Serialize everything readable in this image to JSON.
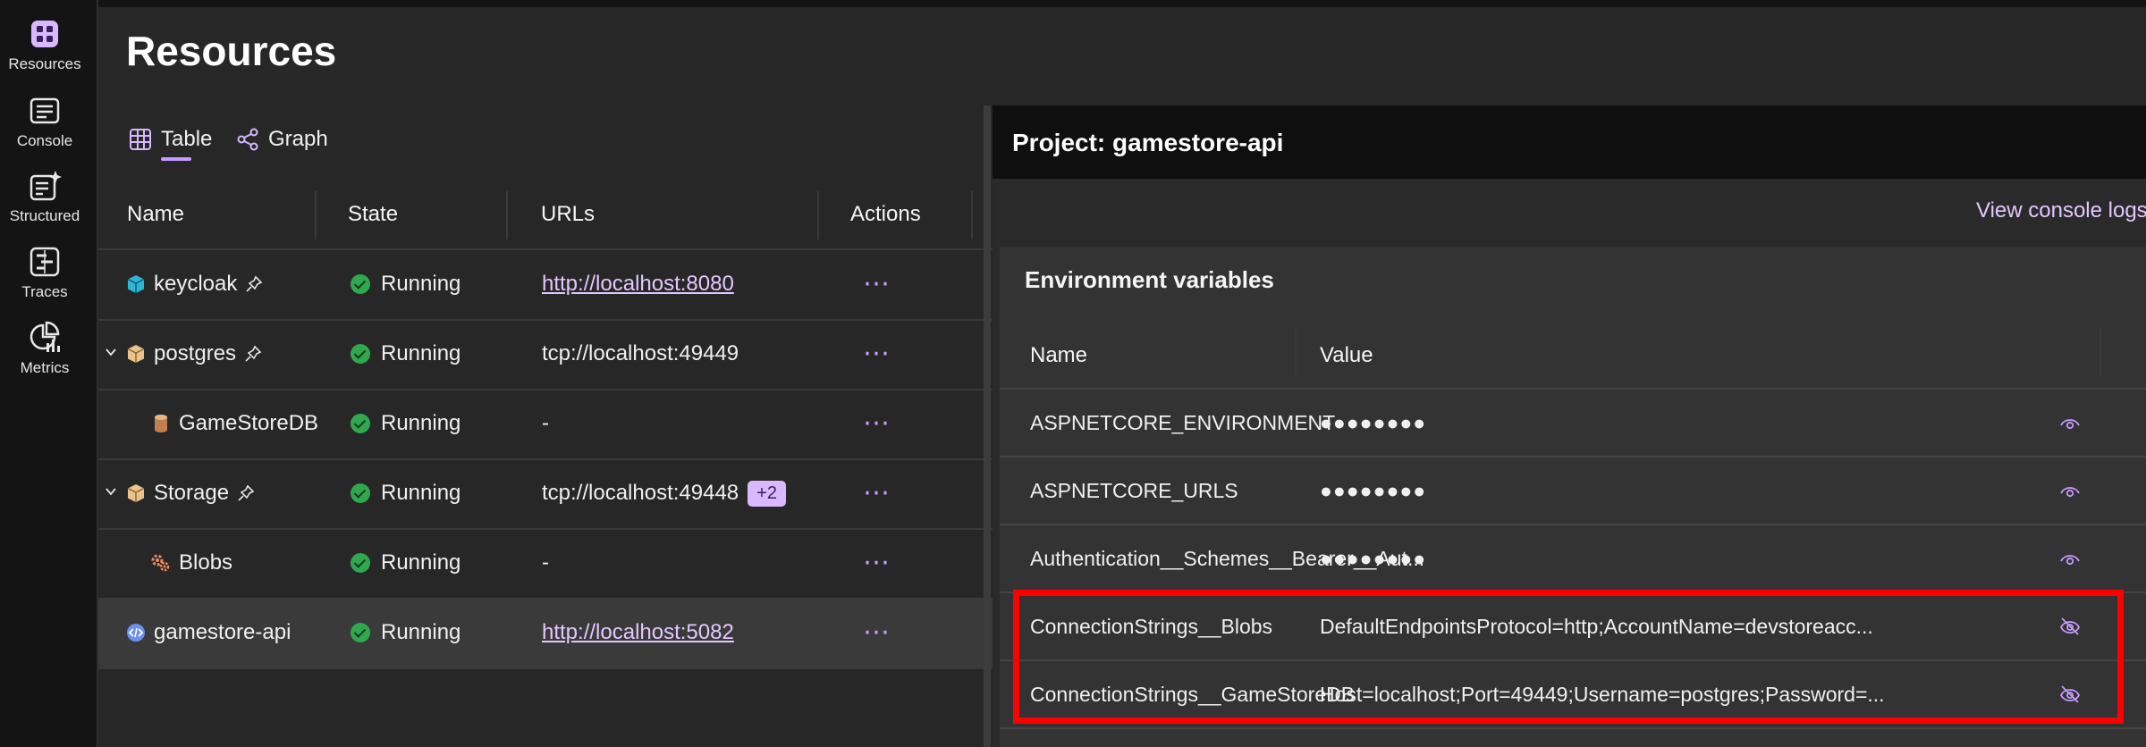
{
  "nav": {
    "items": [
      {
        "label": "Resources",
        "icon": "resources-icon"
      },
      {
        "label": "Console",
        "icon": "console-icon"
      },
      {
        "label": "Structured",
        "icon": "structured-logs-icon"
      },
      {
        "label": "Traces",
        "icon": "traces-icon"
      },
      {
        "label": "Metrics",
        "icon": "metrics-icon"
      }
    ]
  },
  "page": {
    "title": "Resources"
  },
  "tabs": [
    {
      "label": "Table",
      "icon": "table-icon",
      "selected": true
    },
    {
      "label": "Graph",
      "icon": "graph-icon",
      "selected": false
    }
  ],
  "resources": {
    "columns": [
      "Name",
      "State",
      "URLs",
      "Actions"
    ],
    "rows": [
      {
        "name": "keycloak",
        "icon": "container-icon",
        "pinned": true,
        "expandable": false,
        "state": "Running",
        "url": "http://localhost:8080",
        "url_is_link": true,
        "extra": ""
      },
      {
        "name": "postgres",
        "icon": "project-box-icon",
        "pinned": true,
        "expandable": true,
        "state": "Running",
        "url": "tcp://localhost:49449",
        "url_is_link": false,
        "extra": ""
      },
      {
        "name": "GameStoreDB",
        "icon": "database-icon",
        "pinned": false,
        "expandable": false,
        "state": "Running",
        "url": "-",
        "url_is_link": false,
        "extra": ""
      },
      {
        "name": "Storage",
        "icon": "project-box-icon",
        "pinned": true,
        "expandable": true,
        "state": "Running",
        "url": "tcp://localhost:49448",
        "url_is_link": false,
        "extra": "+2"
      },
      {
        "name": "Blobs",
        "icon": "blobs-icon",
        "pinned": false,
        "expandable": false,
        "state": "Running",
        "url": "-",
        "url_is_link": false,
        "extra": ""
      },
      {
        "name": "gamestore-api",
        "icon": "code-project-icon",
        "pinned": false,
        "expandable": false,
        "state": "Running",
        "url": "http://localhost:5082",
        "url_is_link": true,
        "extra": "",
        "selected": true
      }
    ],
    "actions_glyph": "⋯"
  },
  "details": {
    "title": "Project: gamestore-api",
    "view_logs": "View console logs",
    "env": {
      "title": "Environment variables",
      "columns": [
        "Name",
        "Value"
      ],
      "rows": [
        {
          "name": "ASPNETCORE_ENVIRONMENT",
          "value": "●●●●●●●●",
          "masked": true
        },
        {
          "name": "ASPNETCORE_URLS",
          "value": "●●●●●●●●",
          "masked": true
        },
        {
          "name": "Authentication__Schemes__Bearer__Aut...",
          "value": "●●●●●●●●",
          "masked": true
        },
        {
          "name": "ConnectionStrings__Blobs",
          "value": "DefaultEndpointsProtocol=http;AccountName=devstoreacc...",
          "masked": false
        },
        {
          "name": "ConnectionStrings__GameStoreDB",
          "value": "Host=localhost;Port=49449;Username=postgres;Password=...",
          "masked": false
        }
      ]
    }
  },
  "colors": {
    "accent": "#c79bff",
    "running": "#2fa84f",
    "highlight": "#ff0000"
  }
}
